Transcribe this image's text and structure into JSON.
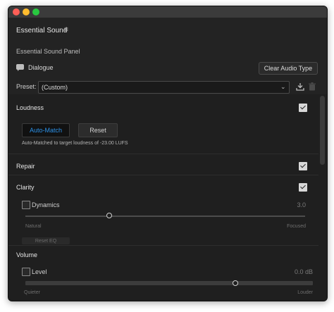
{
  "panel": {
    "title": "Essential Sound",
    "menu_icon": "hamburger-menu-icon",
    "subtitle": "Essential Sound Panel"
  },
  "audio_type": {
    "icon": "speech-bubble-icon",
    "label": "Dialogue",
    "clear_button": "Clear Audio Type"
  },
  "preset": {
    "label": "Preset:",
    "value": "(Custom)",
    "caret_icon": "chevron-down-icon",
    "save_icon": "download-preset-icon",
    "delete_icon": "trash-icon"
  },
  "loudness": {
    "label": "Loudness",
    "checked": true,
    "auto_match_button": "Auto-Match",
    "reset_button": "Reset",
    "info": "Auto-Matched to target loudness of -23.00 LUFS"
  },
  "repair": {
    "label": "Repair",
    "checked": true
  },
  "clarity": {
    "label": "Clarity",
    "checked": true,
    "dynamics": {
      "label": "Dynamics",
      "checked": false,
      "value": "3.0",
      "slider_fraction": 0.3,
      "min_label": "Natural",
      "max_label": "Focused"
    },
    "partial_button": "Reset EQ"
  },
  "volume": {
    "label": "Volume",
    "level": {
      "label": "Level",
      "checked": false,
      "value": "0.0 dB",
      "slider_fraction": 0.73,
      "min_label": "Quieter",
      "max_label": "Louder"
    }
  },
  "colors": {
    "accent": "#2b91e8",
    "panel_bg": "#232323",
    "content_bg": "#1f1f1f"
  }
}
